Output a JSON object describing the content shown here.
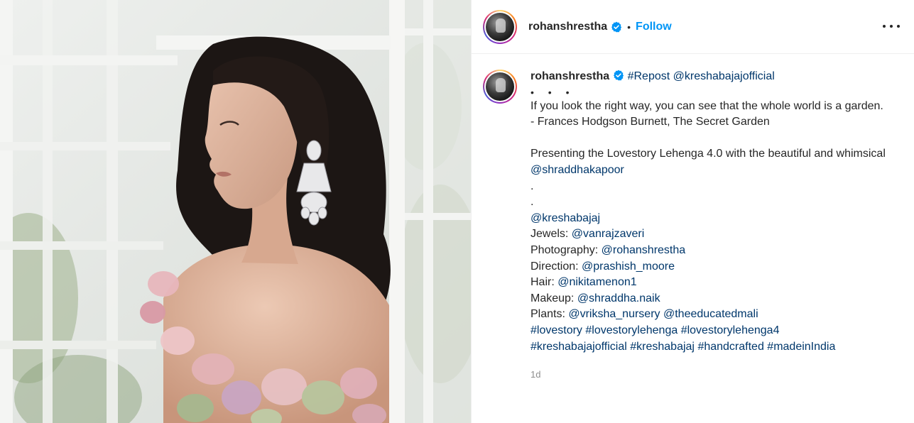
{
  "post": {
    "image_alt": "Woman in floral off-shoulder lehenga with chandelier earrings by a white window frame"
  },
  "header": {
    "username": "rohanshrestha",
    "separator": "•",
    "follow_label": "Follow"
  },
  "caption": {
    "username": "rohanshrestha",
    "repost_tag": "#Repost",
    "repost_user": "@kreshabajajofficial",
    "dots": "• • •",
    "quote_line1": "If you look the right way, you can see that the whole world is a garden.",
    "quote_line2": "- Frances Hodgson Burnett, The Secret Garden",
    "presenting_text": "Presenting the Lovestory Lehenga 4.0 with the beautiful and whimsical ",
    "presenting_mention": "@shraddhakapoor",
    "period1": ".",
    "period2": ".",
    "brand_mention": "@kreshabajaj",
    "jewels_label": "Jewels: ",
    "jewels_mention": "@vanrajzaveri",
    "photography_label": "Photography: ",
    "photography_mention": "@rohanshrestha",
    "direction_label": "Direction: ",
    "direction_mention": "@prashish_moore",
    "hair_label": "Hair: ",
    "hair_mention": "@nikitamenon1",
    "makeup_label": "Makeup: ",
    "makeup_mention": "@shraddha.naik",
    "plants_label": "Plants: ",
    "plants_mention1": "@vriksha_nursery",
    "plants_mention2": "@theeducatedmali",
    "hashtags1": [
      "#lovestory",
      "#lovestorylehenga",
      "#lovestorylehenga4"
    ],
    "hashtags2": [
      "#kreshabajajofficial",
      "#kreshabajaj",
      "#handcrafted",
      "#madeinIndia"
    ],
    "timestamp": "1d"
  },
  "icons": {
    "verified": "verified-badge-icon",
    "more": "more-options-icon"
  },
  "colors": {
    "link": "#00376b",
    "follow": "#0095f6",
    "verified": "#0095f6",
    "muted": "#8e8e8e",
    "text": "#262626"
  }
}
